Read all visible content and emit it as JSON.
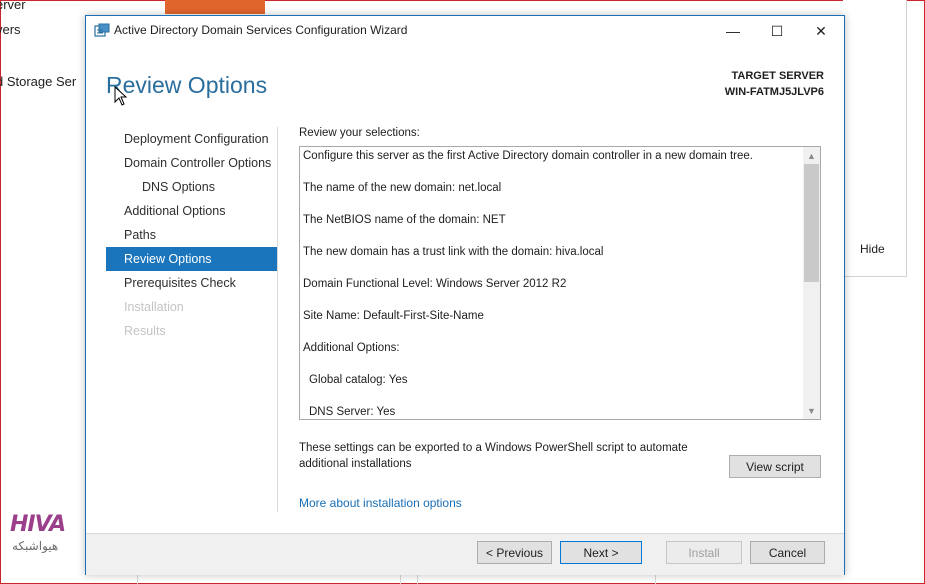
{
  "background": {
    "items": [
      "erver",
      "vers",
      "d Storage Ser"
    ],
    "hide_label": "Hide",
    "brand_top": "HIVA",
    "brand_bottom": "هیواشبکه"
  },
  "window": {
    "title": "Active Directory Domain Services Configuration Wizard",
    "controls": {
      "minimize": "—",
      "maximize": "☐",
      "close": "✕"
    }
  },
  "page": {
    "heading": "Review Options",
    "target_label": "TARGET SERVER",
    "target_name": "WIN-FATMJ5JLVP6"
  },
  "nav": {
    "items": [
      {
        "label": "Deployment Configuration",
        "state": "normal"
      },
      {
        "label": "Domain Controller Options",
        "state": "normal"
      },
      {
        "label": "DNS Options",
        "state": "sub"
      },
      {
        "label": "Additional Options",
        "state": "normal"
      },
      {
        "label": "Paths",
        "state": "normal"
      },
      {
        "label": "Review Options",
        "state": "active"
      },
      {
        "label": "Prerequisites Check",
        "state": "normal"
      },
      {
        "label": "Installation",
        "state": "disabled"
      },
      {
        "label": "Results",
        "state": "disabled"
      }
    ]
  },
  "review": {
    "label": "Review your selections:",
    "lines": [
      "Configure this server as the first Active Directory domain controller in a new domain tree.",
      "The name of the new domain: net.local",
      "The NetBIOS name of the domain: NET",
      "The new domain has a trust link with the domain: hiva.local",
      "Domain Functional Level: Windows Server 2012 R2",
      "Site Name: Default-First-Site-Name",
      "Additional Options:",
      "Global catalog: Yes",
      "DNS Server: Yes"
    ]
  },
  "export": {
    "text_line1": "These settings can be exported to a Windows PowerShell script to automate",
    "text_line2": "additional installations",
    "view_script": "View script"
  },
  "more_link": "More about installation options",
  "footer": {
    "previous": "< Previous",
    "next": "Next >",
    "install": "Install",
    "cancel": "Cancel"
  },
  "colors": {
    "accent": "#1b75bc",
    "heading": "#2a6e9e",
    "link": "#1a6fb5",
    "brand": "#9b3f8a",
    "frame": "#c9252b"
  }
}
